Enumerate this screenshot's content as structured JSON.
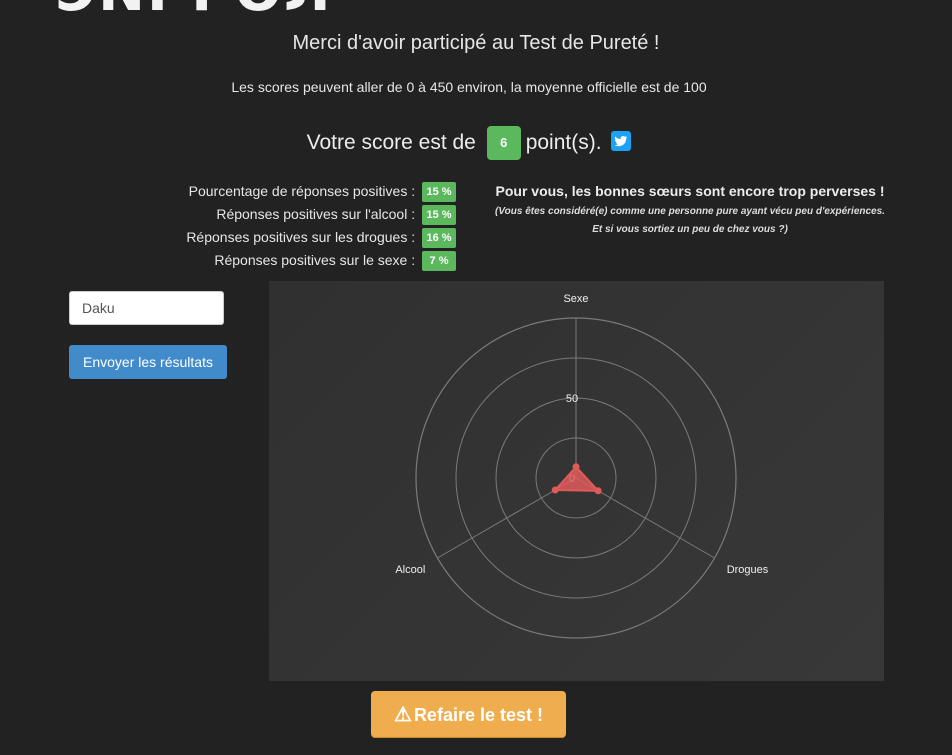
{
  "header": {
    "logo_fragment": "ЭNI POЛ",
    "thanks": "Merci d'avoir participé au Test de Pureté !",
    "range_info": "Les scores peuvent aller de 0 à 450 environ, la moyenne officielle est de 100"
  },
  "score": {
    "prefix": "Votre score est de",
    "value": "6",
    "suffix": "point(s).",
    "share_icon": "twitter-icon"
  },
  "stats": [
    {
      "label": "Pourcentage de réponses positives :",
      "value": "15 %"
    },
    {
      "label": "Réponses positives sur l'alcool :",
      "value": "15 %"
    },
    {
      "label": "Réponses positives sur les drogues :",
      "value": "16 %"
    },
    {
      "label": "Réponses positives sur le sexe :",
      "value": "7 %"
    }
  ],
  "verdict": {
    "title": "Pour vous, les bonnes sœurs sont encore trop perverses !",
    "line1": "(Vous êtes considéré(e) comme une personne pure ayant vécu peu d'expériences.",
    "line2": "Et si vous sortiez un peu de chez vous ?)"
  },
  "form": {
    "name_value": "Daku",
    "send_label": "Envoyer les résultats"
  },
  "chart_data": {
    "type": "radar",
    "axes": [
      "Sexe",
      "Drogues",
      "Alcool"
    ],
    "series": [
      {
        "values": [
          7,
          16,
          15
        ]
      }
    ],
    "scale_labels": [
      "0",
      "50"
    ],
    "range": [
      0,
      100
    ],
    "colors": {
      "fill": "#e05a5a",
      "grid": "#7a7a7a"
    }
  },
  "actions": {
    "retry_label": "Refaire le test !",
    "retry_icon": "warning-icon"
  }
}
